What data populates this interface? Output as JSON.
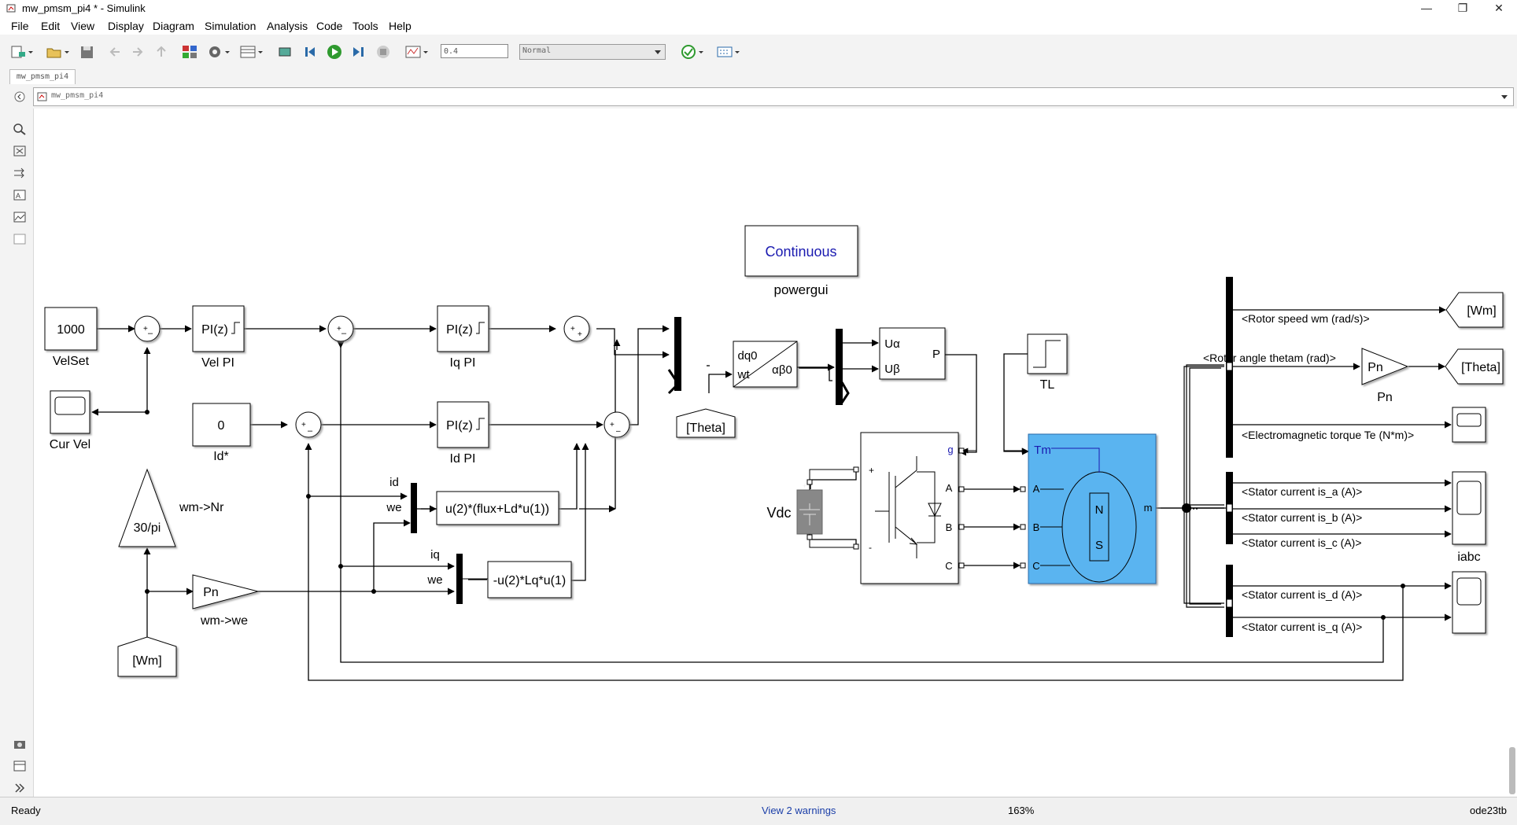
{
  "window": {
    "title": "mw_pmsm_pi4 * - Simulink"
  },
  "menu": [
    "File",
    "Edit",
    "View",
    "Display",
    "Diagram",
    "Simulation",
    "Analysis",
    "Code",
    "Tools",
    "Help"
  ],
  "toolbar": {
    "stop_time": "0.4",
    "sim_mode": "Normal"
  },
  "tab": {
    "label": "mw_pmsm_pi4"
  },
  "address": {
    "path": "mw_pmsm_pi4"
  },
  "blocks": {
    "continuous": "Continuous",
    "powergui": "powergui",
    "velset_value": "1000",
    "velset_name": "VelSet",
    "vel_pi_body": "PI(z)",
    "vel_pi_name": "Vel PI",
    "iq_pi_body": "PI(z)",
    "iq_pi_name": "Iq PI",
    "id_pi_body": "PI(z)",
    "id_pi_name": "Id PI",
    "id_ref_value": "0",
    "id_ref_name": "Id*",
    "cur_vel_name": "Cur Vel",
    "gain_nr_body": "30/pi",
    "gain_nr_name": "wm->Nr",
    "gain_we_body": "Pn",
    "gain_we_name": "wm->we",
    "wm_from": "[Wm]",
    "fcn1": "u(2)*(flux+Ld*u(1))",
    "fcn2": "-u(2)*Lq*u(1)",
    "mux1_in1": "id",
    "mux1_in2": "we",
    "mux2_in1": "iq",
    "mux2_in2": "we",
    "park_in1": "dq0",
    "park_in2": "wt",
    "park_out": "αβ0",
    "theta_from": "[Theta]",
    "svpwm_in1": "Uα",
    "svpwm_in2": "Uβ",
    "svpwm_out": "P",
    "tl_name": "TL",
    "vdc_name": "Vdc",
    "inv_g": "g",
    "inv_a": "A",
    "inv_b": "B",
    "inv_c": "C",
    "inv_plus": "+",
    "inv_minus": "-",
    "motor_tm": "Tm",
    "motor_a": "A",
    "motor_b": "B",
    "motor_c": "C",
    "motor_m": "m",
    "motor_n": "N",
    "motor_s": "S",
    "pn_gain_body": "Pn",
    "pn_gain_name": "Pn",
    "goto_wm": "[Wm]",
    "goto_theta": "[Theta]",
    "iabc_name": "iabc",
    "sig_speed": "<Rotor speed wm (rad/s)>",
    "sig_angle": "<Rotor angle thetam (rad)>",
    "sig_torque": "<Electromagnetic torque Te (N*m)>",
    "sig_isa": "<Stator current is_a (A)>",
    "sig_isb": "<Stator current is_b (A)>",
    "sig_isc": "<Stator current is_c (A)>",
    "sig_isd": "<Stator current is_d (A)>",
    "sig_isq": "<Stator current is_q (A)>"
  },
  "status": {
    "state": "Ready",
    "warnings": "View 2 warnings",
    "zoom": "163%",
    "solver": "ode23tb"
  }
}
